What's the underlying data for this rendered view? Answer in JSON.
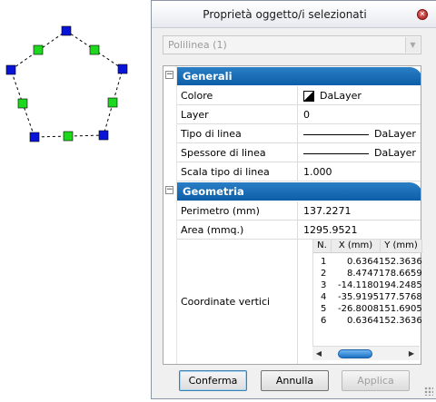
{
  "canvas": {
    "description_hidden": ""
  },
  "dialog": {
    "title": "Proprietà oggetto/i selezionati",
    "close_glyph": "✕",
    "selector": {
      "value": "Polilinea (1)"
    }
  },
  "grid": {
    "categories": [
      {
        "label": "Generali",
        "toggle": "−"
      },
      {
        "label": "Geometria",
        "toggle": "−"
      }
    ],
    "general": {
      "color": {
        "label": "Colore",
        "value": "DaLayer"
      },
      "layer": {
        "label": "Layer",
        "value": "0"
      },
      "linetype": {
        "label": "Tipo di linea",
        "value": "DaLayer"
      },
      "lineweight": {
        "label": "Spessore di linea",
        "value": "DaLayer"
      },
      "linescale": {
        "label": "Scala tipo di linea",
        "value": "1.000"
      }
    },
    "geometry": {
      "perimeter": {
        "label": "Perimetro (mm)",
        "value": "137.2271"
      },
      "area": {
        "label": "Area (mmq.)",
        "value": "1295.9521"
      },
      "vertices": {
        "label": "Coordinate vertici",
        "headers": [
          "N.",
          "X (mm)",
          "Y (mm)"
        ],
        "rows": [
          [
            "1",
            "0.6364",
            "152.3636"
          ],
          [
            "2",
            "8.4747",
            "178.6659"
          ],
          [
            "3",
            "-14.1180",
            "194.2485"
          ],
          [
            "4",
            "-35.9195",
            "177.5768"
          ],
          [
            "5",
            "-26.8008",
            "151.6905"
          ],
          [
            "6",
            "0.6364",
            "152.3636"
          ]
        ]
      }
    }
  },
  "buttons": {
    "ok": "Conferma",
    "cancel": "Annulla",
    "apply": "Applica"
  },
  "colors": {
    "category_bar": "#1a6bb8",
    "grip_vertex": "#0a14d8",
    "grip_midpoint": "#1ed81e"
  }
}
